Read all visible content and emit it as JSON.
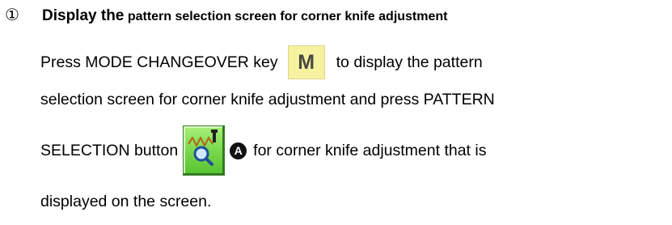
{
  "step": {
    "number": "①",
    "title_main": "Display the",
    "title_sub": " pattern selection screen for corner knife adjustment"
  },
  "body": {
    "line1_before": "Press MODE CHANGEOVER key",
    "mode_key_label": "M",
    "line1_after": "to display the pattern",
    "line2": "selection screen for corner knife adjustment and press PATTERN",
    "line3_before": "SELECTION button",
    "callout_label": "A",
    "line3_after": "for corner knife adjustment that is",
    "line4": "displayed on the screen."
  },
  "icons": {
    "pattern_button": "pattern-selection-magnifier-icon"
  },
  "colors": {
    "mode_key_bg": "#f7f2a0",
    "pattern_button_bg": "#79d94d",
    "callout_bg": "#111111"
  }
}
